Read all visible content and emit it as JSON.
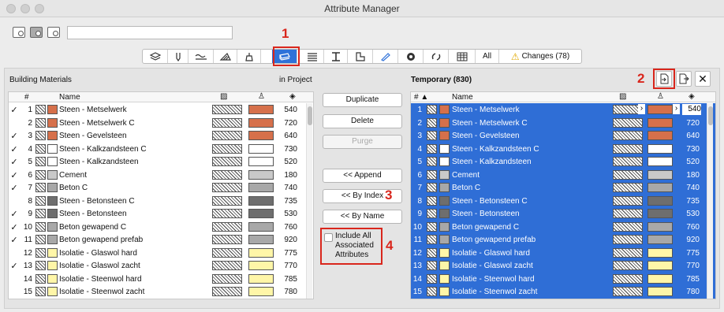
{
  "window": {
    "title": "Attribute Manager"
  },
  "toolbar": {
    "view_icons": [
      "list-view-icon",
      "split-view-icon",
      "detail-view-icon"
    ],
    "search": {
      "value": "",
      "placeholder": ""
    }
  },
  "tabs": [
    {
      "name": "layers-icon",
      "label": ""
    },
    {
      "name": "pens-icon",
      "label": ""
    },
    {
      "name": "linetypes-icon",
      "label": ""
    },
    {
      "name": "fills-icon",
      "label": ""
    },
    {
      "name": "surfaces-icon",
      "label": ""
    },
    {
      "name": "building-materials-icon",
      "label": ""
    },
    {
      "name": "composites-icon",
      "label": ""
    },
    {
      "name": "profiles-icon",
      "label": ""
    },
    {
      "name": "zone-categories-icon",
      "label": ""
    },
    {
      "name": "markup-styles-icon",
      "label": ""
    },
    {
      "name": "mep-systems-icon",
      "label": ""
    },
    {
      "name": "renovation-icon",
      "label": ""
    },
    {
      "name": "operation-profiles-icon",
      "label": ""
    },
    {
      "name": "all-tab",
      "label": "All"
    },
    {
      "name": "changes-tab",
      "label": "Changes (78)"
    }
  ],
  "annotations": {
    "n1": "1",
    "n2": "2",
    "n3": "3",
    "n4": "4"
  },
  "left_panel": {
    "title": "Building Materials",
    "location": "in Project"
  },
  "right_panel": {
    "title": "Temporary (830)"
  },
  "columns": {
    "index": "#",
    "index_sorted": "# ▲",
    "name": "Name"
  },
  "actions": {
    "duplicate": "Duplicate",
    "delete": "Delete",
    "purge": "Purge",
    "append": "<< Append",
    "by_index": "<< By Index",
    "by_name": "<< By Name",
    "include_all": "Include All Associated Attributes"
  },
  "colors": {
    "accent": "#2f6ed6",
    "annotation": "#d9261c"
  },
  "left_rows": [
    {
      "check": "✓",
      "index": "1",
      "name": "Steen - Metselwerk",
      "color": "#d6704b",
      "value": "540"
    },
    {
      "check": "",
      "index": "2",
      "name": "Steen - Metselwerk C",
      "color": "#d6704b",
      "value": "720"
    },
    {
      "check": "✓",
      "index": "3",
      "name": "Steen - Gevelsteen",
      "color": "#d6704b",
      "value": "640"
    },
    {
      "check": "✓",
      "index": "4",
      "name": "Steen - Kalkzandsteen C",
      "color": "#ffffff",
      "value": "730"
    },
    {
      "check": "✓",
      "index": "5",
      "name": "Steen - Kalkzandsteen",
      "color": "#ffffff",
      "value": "520"
    },
    {
      "check": "✓",
      "index": "6",
      "name": "Cement",
      "color": "#c9c9c9",
      "value": "180"
    },
    {
      "check": "✓",
      "index": "7",
      "name": "Beton C",
      "color": "#a8a8a8",
      "value": "740"
    },
    {
      "check": "",
      "index": "8",
      "name": "Steen - Betonsteen C",
      "color": "#6e6e6e",
      "value": "735"
    },
    {
      "check": "✓",
      "index": "9",
      "name": "Steen - Betonsteen",
      "color": "#6e6e6e",
      "value": "530"
    },
    {
      "check": "✓",
      "index": "10",
      "name": "Beton gewapend C",
      "color": "#a8a8a8",
      "value": "760"
    },
    {
      "check": "✓",
      "index": "11",
      "name": "Beton gewapend prefab",
      "color": "#a8a8a8",
      "value": "920"
    },
    {
      "check": "",
      "index": "12",
      "name": "Isolatie - Glaswol hard",
      "color": "#fff6a8",
      "value": "775"
    },
    {
      "check": "✓",
      "index": "13",
      "name": "Isolatie - Glaswol zacht",
      "color": "#fff6a8",
      "value": "770"
    },
    {
      "check": "",
      "index": "14",
      "name": "Isolatie - Steenwol hard",
      "color": "#fff6a8",
      "value": "785"
    },
    {
      "check": "",
      "index": "15",
      "name": "Isolatie - Steenwol zacht",
      "color": "#fff6a8",
      "value": "780"
    }
  ],
  "right_rows": [
    {
      "index": "1",
      "name": "Steen - Metselwerk",
      "color": "#d6704b",
      "value": "540"
    },
    {
      "index": "2",
      "name": "Steen - Metselwerk C",
      "color": "#d6704b",
      "value": "720"
    },
    {
      "index": "3",
      "name": "Steen - Gevelsteen",
      "color": "#d6704b",
      "value": "640"
    },
    {
      "index": "4",
      "name": "Steen - Kalkzandsteen C",
      "color": "#ffffff",
      "value": "730"
    },
    {
      "index": "5",
      "name": "Steen - Kalkzandsteen",
      "color": "#ffffff",
      "value": "520"
    },
    {
      "index": "6",
      "name": "Cement",
      "color": "#c9c9c9",
      "value": "180"
    },
    {
      "index": "7",
      "name": "Beton C",
      "color": "#a8a8a8",
      "value": "740"
    },
    {
      "index": "8",
      "name": "Steen - Betonsteen C",
      "color": "#6e6e6e",
      "value": "735"
    },
    {
      "index": "9",
      "name": "Steen - Betonsteen",
      "color": "#6e6e6e",
      "value": "530"
    },
    {
      "index": "10",
      "name": "Beton gewapend C",
      "color": "#a8a8a8",
      "value": "760"
    },
    {
      "index": "11",
      "name": "Beton gewapend prefab",
      "color": "#a8a8a8",
      "value": "920"
    },
    {
      "index": "12",
      "name": "Isolatie - Glaswol hard",
      "color": "#fff6a8",
      "value": "775"
    },
    {
      "index": "13",
      "name": "Isolatie - Glaswol zacht",
      "color": "#fff6a8",
      "value": "770"
    },
    {
      "index": "14",
      "name": "Isolatie - Steenwol hard",
      "color": "#fff6a8",
      "value": "785"
    },
    {
      "index": "15",
      "name": "Isolatie - Steenwol zacht",
      "color": "#fff6a8",
      "value": "780"
    }
  ]
}
